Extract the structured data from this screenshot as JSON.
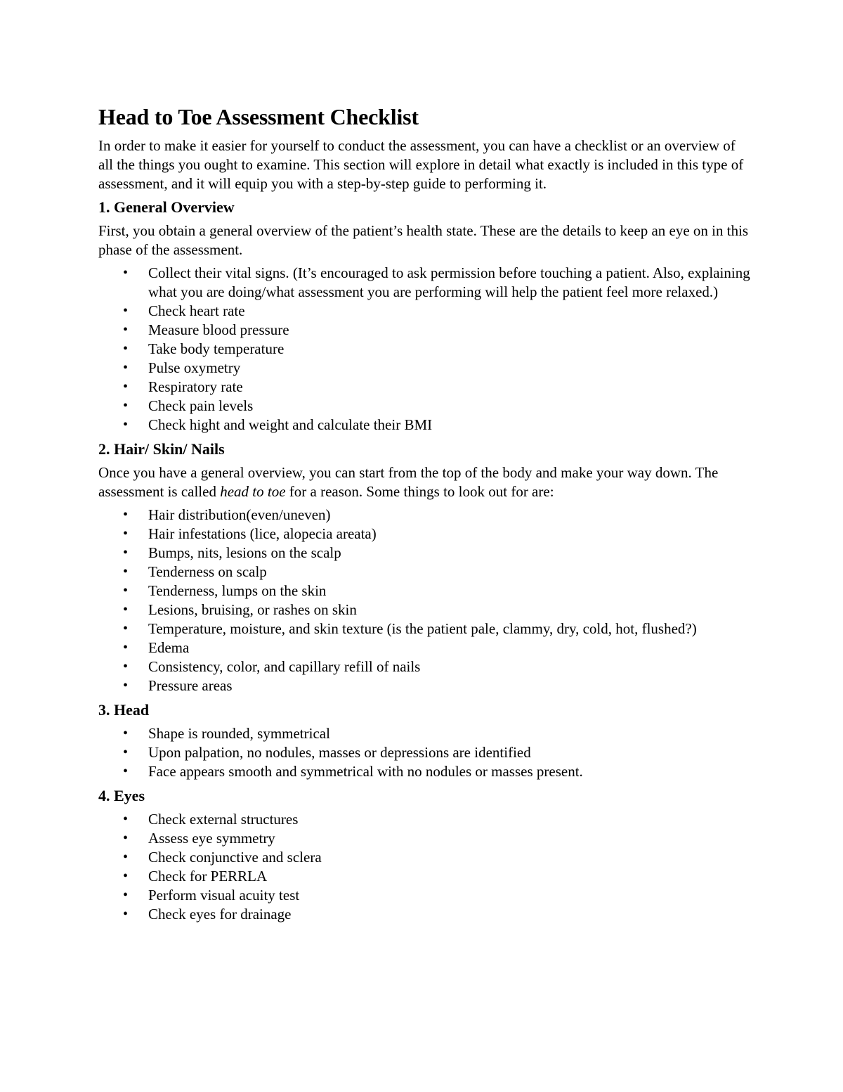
{
  "document": {
    "title": "Head to Toe Assessment Checklist",
    "intro": "In order to make it easier for yourself to conduct the assessment, you can have a checklist or an overview of all the things you ought to examine. This section will explore in detail what exactly is included in this type of assessment, and it will equip you with a step-by-step guide to performing it.",
    "bullet_glyph": "•",
    "sections": [
      {
        "heading": "1. General Overview",
        "paragraph": "First, you obtain a general overview of the patient’s health state. These are the details to keep an eye on in this phase of the assessment.",
        "items": [
          "Collect their vital signs. (It’s encouraged to ask permission before touching a patient. Also, explaining what you are doing/what assessment you are performing will help the patient feel more relaxed.)",
          "Check heart rate",
          "Measure blood pressure",
          "Take body temperature",
          "Pulse oxymetry",
          "Respiratory rate",
          "Check pain levels",
          "Check hight and weight and calculate their BMI"
        ]
      },
      {
        "heading": "2. Hair/ Skin/ Nails",
        "paragraph_before_italic": "Once you have a general overview, you can start from the top of the body and make your way down. The assessment is called ",
        "paragraph_italic": "head to toe",
        "paragraph_after_italic": " for a reason. Some things to look out for are:",
        "items": [
          "Hair distribution(even/uneven)",
          "Hair infestations (lice, alopecia areata)",
          "Bumps, nits, lesions on the scalp",
          "Tenderness on scalp",
          "Tenderness, lumps on the skin",
          "Lesions, bruising, or rashes on skin",
          "Temperature, moisture, and skin texture (is the patient pale, clammy, dry, cold, hot, flushed?)",
          "Edema",
          "Consistency, color, and capillary refill of nails",
          "Pressure areas"
        ]
      },
      {
        "heading": "3. Head",
        "items": [
          "Shape is rounded, symmetrical",
          "Upon palpation, no nodules, masses or depressions are identified",
          "Face appears smooth and symmetrical with no nodules or masses present."
        ]
      },
      {
        "heading": "4. Eyes",
        "items": [
          "Check external structures",
          "Assess eye symmetry",
          "Check conjunctive and sclera",
          "Check for PERRLA",
          "Perform visual acuity test",
          "Check eyes for drainage"
        ]
      }
    ]
  }
}
